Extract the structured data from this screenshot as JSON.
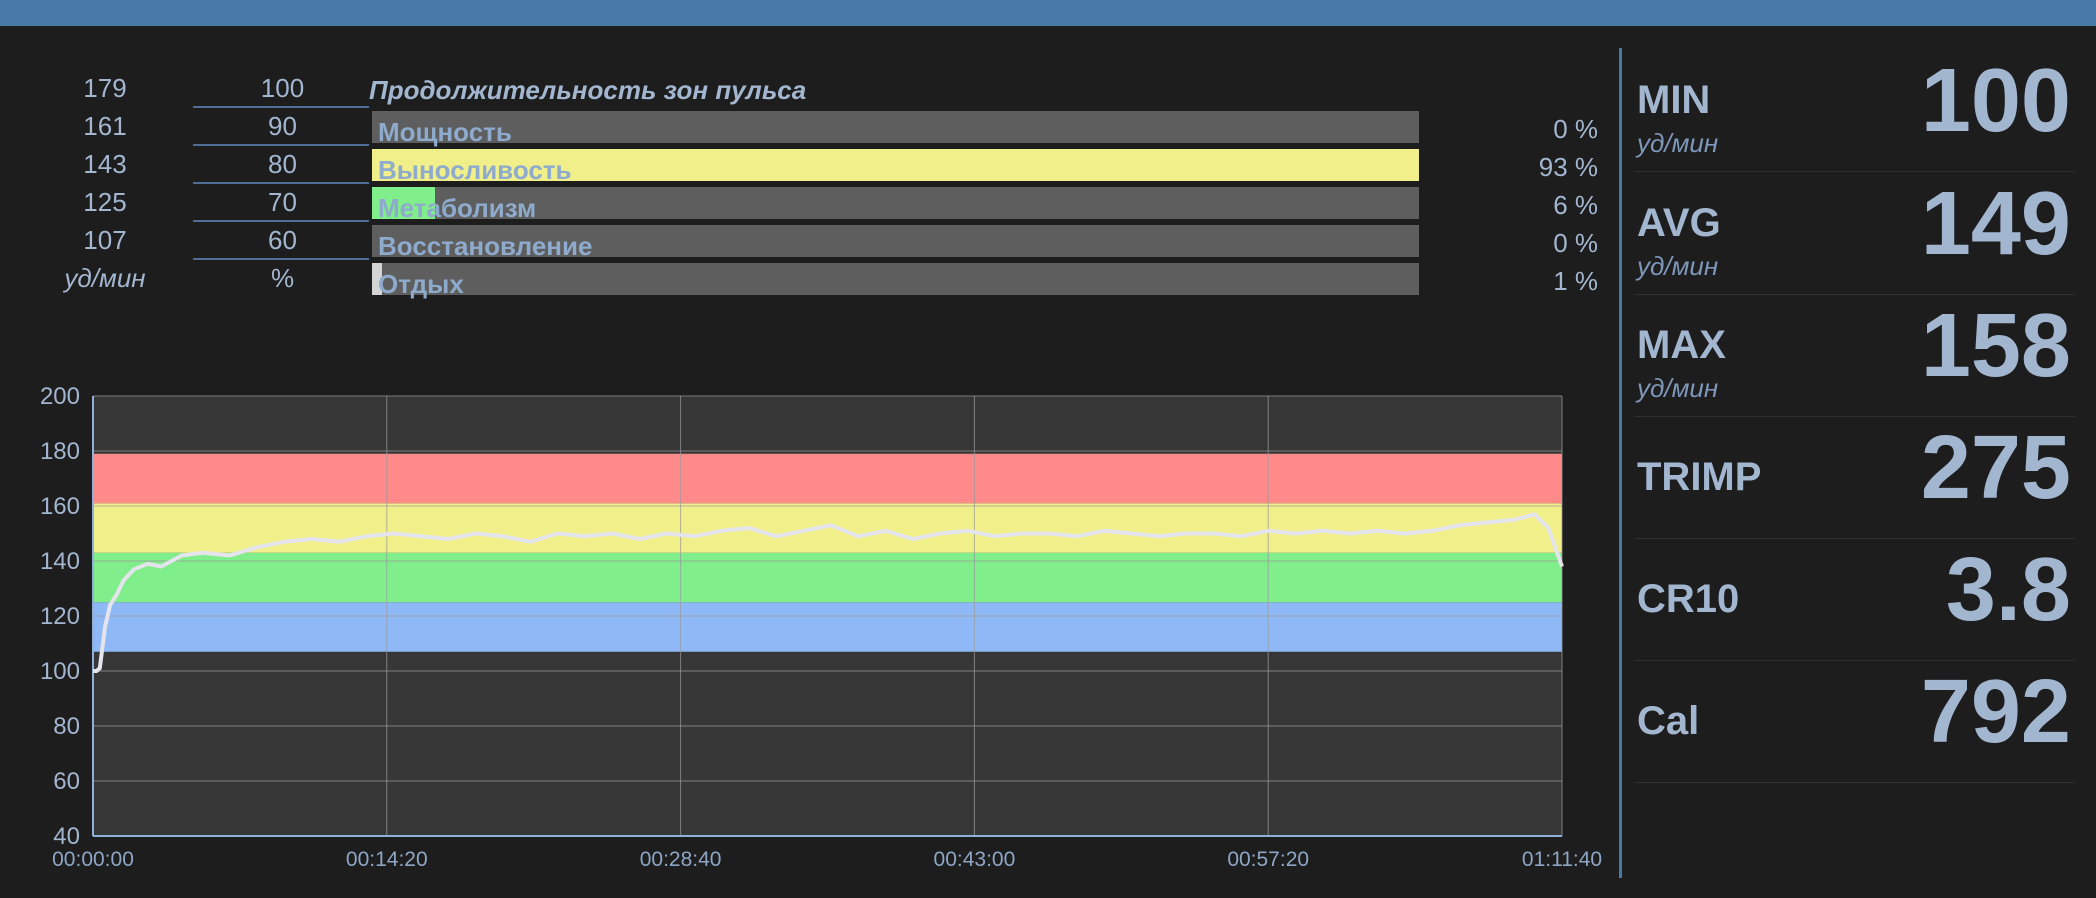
{
  "colors": {
    "topbar": "#4678a8",
    "panel_bg": "#1d1d1d",
    "chart_bg": "#363636",
    "bar_bg": "#5e5e5e",
    "text": "#a3b6d0",
    "zone_red": "#ff8a8a",
    "zone_yellow": "#f0ef8a",
    "zone_green": "#80ee8a",
    "zone_blue": "#8fb9f6",
    "rest": "#d4d4d4",
    "hr_line": "#e4e4ec"
  },
  "zones": {
    "title": "Продолжительность зон пульса",
    "unit_bpm": "уд/мин",
    "unit_pct": "%",
    "rows": [
      {
        "bpm": "179",
        "pct": "100",
        "label": "Мощность",
        "value": "0 %",
        "fraction": 0.0,
        "color": "#ff8a8a"
      },
      {
        "bpm": "161",
        "pct": "90",
        "label": "Выносливость",
        "value": "93 %",
        "fraction": 1.0,
        "color": "#f0ef8a"
      },
      {
        "bpm": "143",
        "pct": "80",
        "label": "Метаболизм",
        "value": "6 %",
        "fraction": 0.06,
        "color": "#80ee8a"
      },
      {
        "bpm": "125",
        "pct": "70",
        "label": "Восстановление",
        "value": "0 %",
        "fraction": 0.0,
        "color": "#8fb9f6"
      },
      {
        "bpm": "107",
        "pct": "60",
        "label": "Отдых",
        "value": "1 %",
        "fraction": 0.01,
        "color": "#d4d4d4"
      }
    ]
  },
  "chart_data": {
    "type": "line",
    "title": "",
    "xlabel": "",
    "ylabel": "",
    "ylim": [
      40,
      200
    ],
    "xlim_seconds": [
      0,
      4300
    ],
    "y_ticks": [
      "40",
      "60",
      "80",
      "100",
      "120",
      "140",
      "160",
      "180",
      "200"
    ],
    "x_ticks": [
      "00:00:00",
      "00:14:20",
      "00:28:40",
      "00:43:00",
      "00:57:20",
      "01:11:40"
    ],
    "grid": true,
    "zone_bands": [
      {
        "from": 107,
        "to": 125,
        "color": "#8fb9f6"
      },
      {
        "from": 125,
        "to": 143,
        "color": "#80ee8a"
      },
      {
        "from": 143,
        "to": 161,
        "color": "#f0ef8a"
      },
      {
        "from": 161,
        "to": 179,
        "color": "#ff8a8a"
      }
    ],
    "series": [
      {
        "t_seconds": [
          0,
          10,
          20,
          35,
          50,
          70,
          90,
          120,
          160,
          200,
          260,
          320,
          400,
          480,
          560,
          640,
          720,
          800,
          880,
          960,
          1040,
          1120,
          1200,
          1280,
          1360,
          1440,
          1520,
          1600,
          1680,
          1760,
          1840,
          1920,
          2000,
          2080,
          2160,
          2240,
          2320,
          2400,
          2480,
          2560,
          2640,
          2720,
          2800,
          2880,
          2960,
          3040,
          3120,
          3200,
          3280,
          3360,
          3440,
          3520,
          3600,
          3680,
          3760,
          3840,
          3920,
          4000,
          4080,
          4160,
          4220,
          4260,
          4300
        ],
        "bpm": [
          100,
          100,
          101,
          116,
          124,
          128,
          133,
          137,
          139,
          138,
          142,
          143,
          142,
          145,
          147,
          148,
          147,
          149,
          150,
          149,
          148,
          150,
          149,
          147,
          150,
          149,
          150,
          148,
          150,
          149,
          151,
          152,
          149,
          151,
          153,
          149,
          151,
          148,
          150,
          151,
          149,
          150,
          150,
          149,
          151,
          150,
          149,
          150,
          150,
          149,
          151,
          150,
          151,
          150,
          151,
          150,
          151,
          153,
          154,
          155,
          157,
          152,
          138
        ]
      }
    ]
  },
  "stats": [
    {
      "label": "MIN",
      "unit": "уд/мин",
      "value": "100"
    },
    {
      "label": "AVG",
      "unit": "уд/мин",
      "value": "149"
    },
    {
      "label": "MAX",
      "unit": "уд/мин",
      "value": "158"
    },
    {
      "label": "TRIMP",
      "unit": "",
      "value": "275"
    },
    {
      "label": "CR10",
      "unit": "",
      "value": "3.8"
    },
    {
      "label": "Cal",
      "unit": "",
      "value": "792"
    }
  ]
}
